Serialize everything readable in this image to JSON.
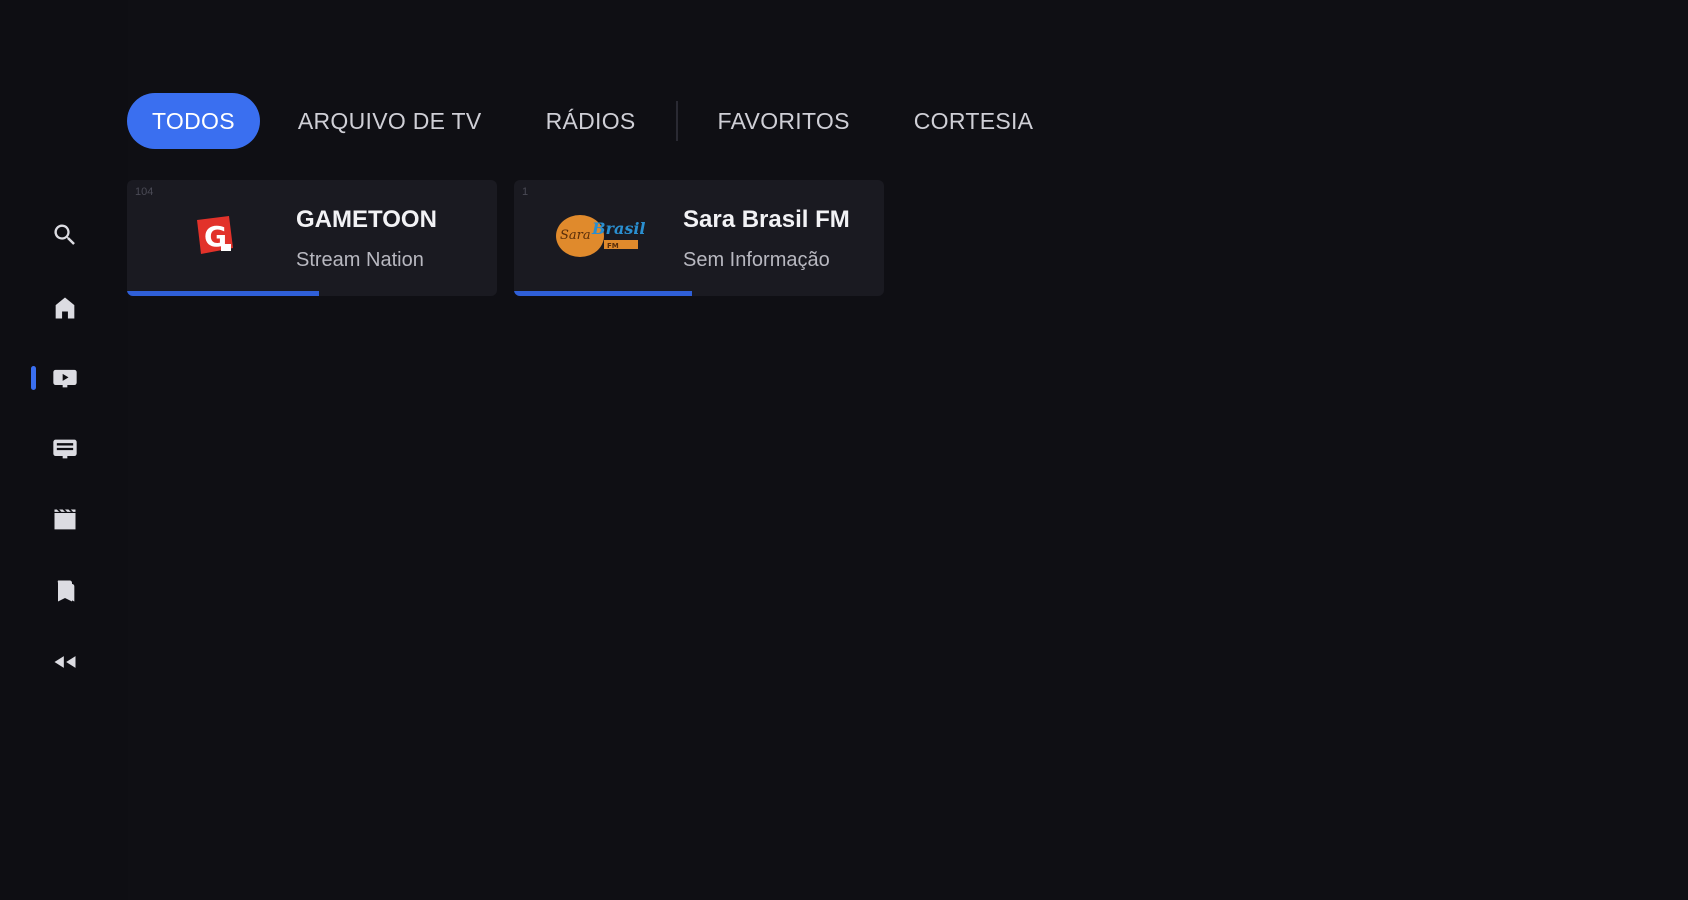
{
  "sidebar": {
    "items": [
      {
        "icon": "search-icon"
      },
      {
        "icon": "home-icon"
      },
      {
        "icon": "tv-channel-icon",
        "active": true
      },
      {
        "icon": "guide-icon"
      },
      {
        "icon": "movies-icon"
      },
      {
        "icon": "library-icon"
      },
      {
        "icon": "rewind-icon"
      }
    ]
  },
  "tabs": [
    {
      "label": "TODOS",
      "active": true
    },
    {
      "label": "ARQUIVO DE TV"
    },
    {
      "label": "RÁDIOS"
    },
    {
      "label": "FAVORITOS"
    },
    {
      "label": "CORTESIA"
    }
  ],
  "channels": [
    {
      "number": "104",
      "title": "GAMETOON",
      "subtitle": "Stream Nation",
      "logo_icon": "gametoon-logo",
      "progress": 0.52
    },
    {
      "number": "1",
      "title": "Sara Brasil FM",
      "subtitle": "Sem Informação",
      "logo_icon": "sara-brasil-fm-logo",
      "progress": 0.48
    }
  ],
  "colors": {
    "accent": "#3a6ff0",
    "background": "#0f0f14",
    "card": "#1a1a21"
  }
}
